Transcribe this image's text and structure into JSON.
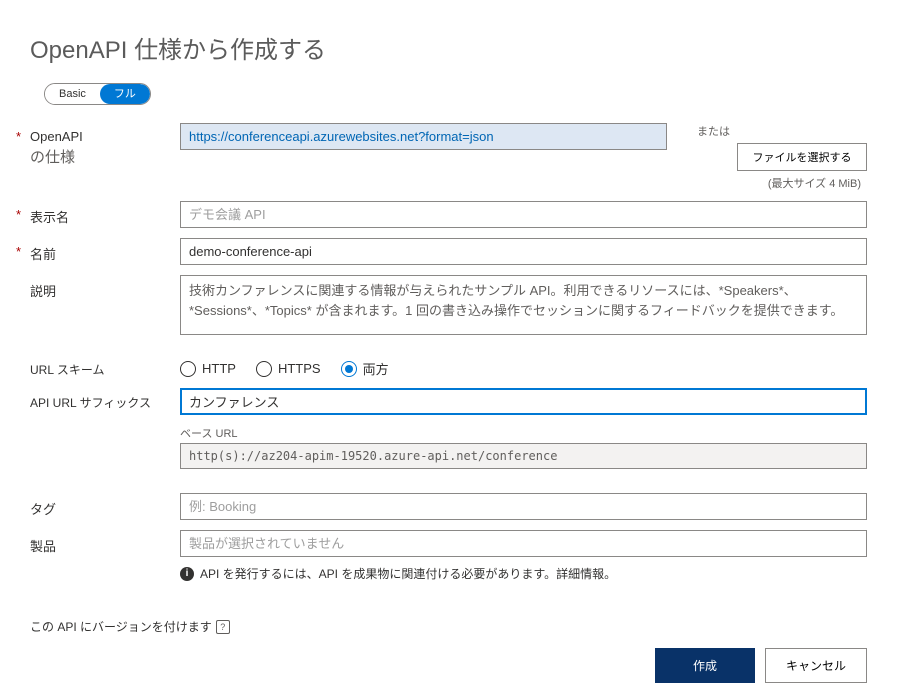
{
  "title": "OpenAPI 仕様から作成する",
  "toggle": {
    "basic": "Basic",
    "full": "フル"
  },
  "openapi": {
    "label": "OpenAPI",
    "sublabel": "の仕様",
    "value": "https://conferenceapi.azurewebsites.net?format=json",
    "or": "または",
    "file_button": "ファイルを選択する",
    "max_size": "(最大サイズ 4 MiB)"
  },
  "display_name": {
    "label": "表示名",
    "placeholder": "デモ会議 API"
  },
  "name": {
    "label": "名前",
    "value": "demo-conference-api"
  },
  "description": {
    "label": "説明",
    "value": "技術カンファレンスに関連する情報が与えられたサンプル API。利用できるリソースには、*Speakers*、*Sessions*、*Topics* が含まれます。1 回の書き込み操作でセッションに関するフィードバックを提供できます。"
  },
  "url_scheme": {
    "label": "URL スキーム",
    "options": {
      "http": "HTTP",
      "https": "HTTPS",
      "both": "両方"
    },
    "selected": "both"
  },
  "suffix": {
    "label": "API URL サフィックス",
    "value": "カンファレンス",
    "base_label": "ベース URL",
    "base_value": "http(s)://az204-apim-19520.azure-api.net/conference"
  },
  "tags": {
    "label": "タグ",
    "placeholder": "例: Booking"
  },
  "products": {
    "label": "製品",
    "placeholder": "製品が選択されていません",
    "info": "API を発行するには、API を成果物に関連付ける必要があります。詳細情報。"
  },
  "version": {
    "label": "この API にバージョンを付けます"
  },
  "footer": {
    "create": "作成",
    "cancel": "キャンセル"
  }
}
